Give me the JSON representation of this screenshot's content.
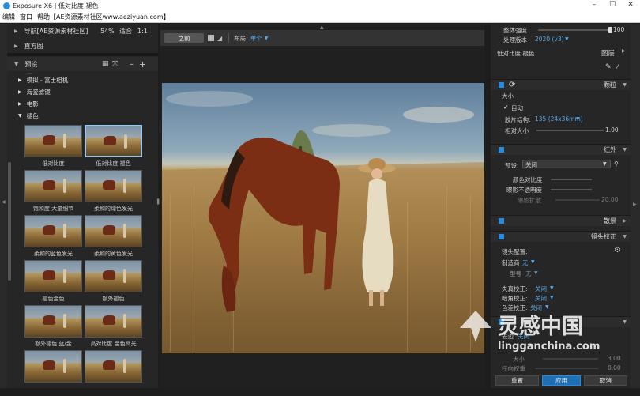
{
  "titlebar": {
    "title": "Exposure X6 | 低对比度 褪色",
    "minimize": "–",
    "maximize": "☐",
    "close": "✕"
  },
  "menu": [
    "编辑",
    "窗口",
    "帮助【AE资源素材社区www.aeziyuan.com】"
  ],
  "left": {
    "nav_label": "导航[AE资源素材社区]",
    "zoom": "54%",
    "fit": "适合",
    "ratio": "1:1",
    "histogram": "直方图",
    "presets": "预设",
    "preset_partial": "...",
    "tree": [
      {
        "label": "模拟 - 富士相机",
        "open": false
      },
      {
        "label": "海瓷滤镜",
        "open": false
      },
      {
        "label": "电影",
        "open": false
      },
      {
        "label": "褪色",
        "open": true
      }
    ],
    "thumbs": [
      [
        "低对比度",
        "低对比度 褪色"
      ],
      [
        "饱和度 大量细节",
        "柔和的绿色发光"
      ],
      [
        "柔和的蓝色发光",
        "柔和的黄色发光"
      ],
      [
        "褪色金色",
        "额外褪色"
      ],
      [
        "额外褪色 蓝/金",
        "高对比度 金色高光"
      ],
      [
        "",
        ""
      ]
    ],
    "selected_thumb": "低对比度 褪色"
  },
  "toolbar": {
    "before": "之前",
    "layout_label": "布局:",
    "layout_value": "单个"
  },
  "right": {
    "strength_label": "整体强度",
    "strength_value": "100",
    "strength_level": 1.0,
    "version_label": "处理版本",
    "version_value": "2020 (v3)",
    "preset_name": "低对比度 褪色",
    "layers": "图层",
    "grain": {
      "title": "颗粒",
      "size": "大小",
      "auto": "自动",
      "film_label": "胶片结构:",
      "film_value": "135 (24x36mm)",
      "rel_label": "相对大小",
      "rel_value": "1.00"
    },
    "infrared": {
      "title": "红外",
      "preset_label": "预设:",
      "preset_value": "关闭",
      "contrast": "颜色对比度",
      "opacity": "曝影不透明度",
      "diffuse": "曝影扩散",
      "diffuse_value": "20.00"
    },
    "bokeh": {
      "title": "散景"
    },
    "lens": {
      "title": "镜头校正",
      "config": "镜头配置:",
      "maker_label": "制造商",
      "maker_value": "无",
      "model_label": "型号",
      "model_value": "无",
      "distortion": "失真校正:",
      "vignette": "暗角校正:",
      "chroma": "色差校正:",
      "off": "关闭"
    },
    "partial": {
      "remove": "去边",
      "remove_val": "关闭",
      "size": "大小",
      "size_value": "3.00",
      "radial": "径向权重",
      "radial_value": "0.00"
    },
    "buttons": {
      "reset": "重置",
      "apply": "应用",
      "cancel": "取消"
    }
  },
  "watermark": {
    "brand": "灵感中国",
    "url": "lingganchina.com"
  },
  "colors": {
    "accent": "#2b8ad9",
    "apply": "#1e6fb3"
  }
}
